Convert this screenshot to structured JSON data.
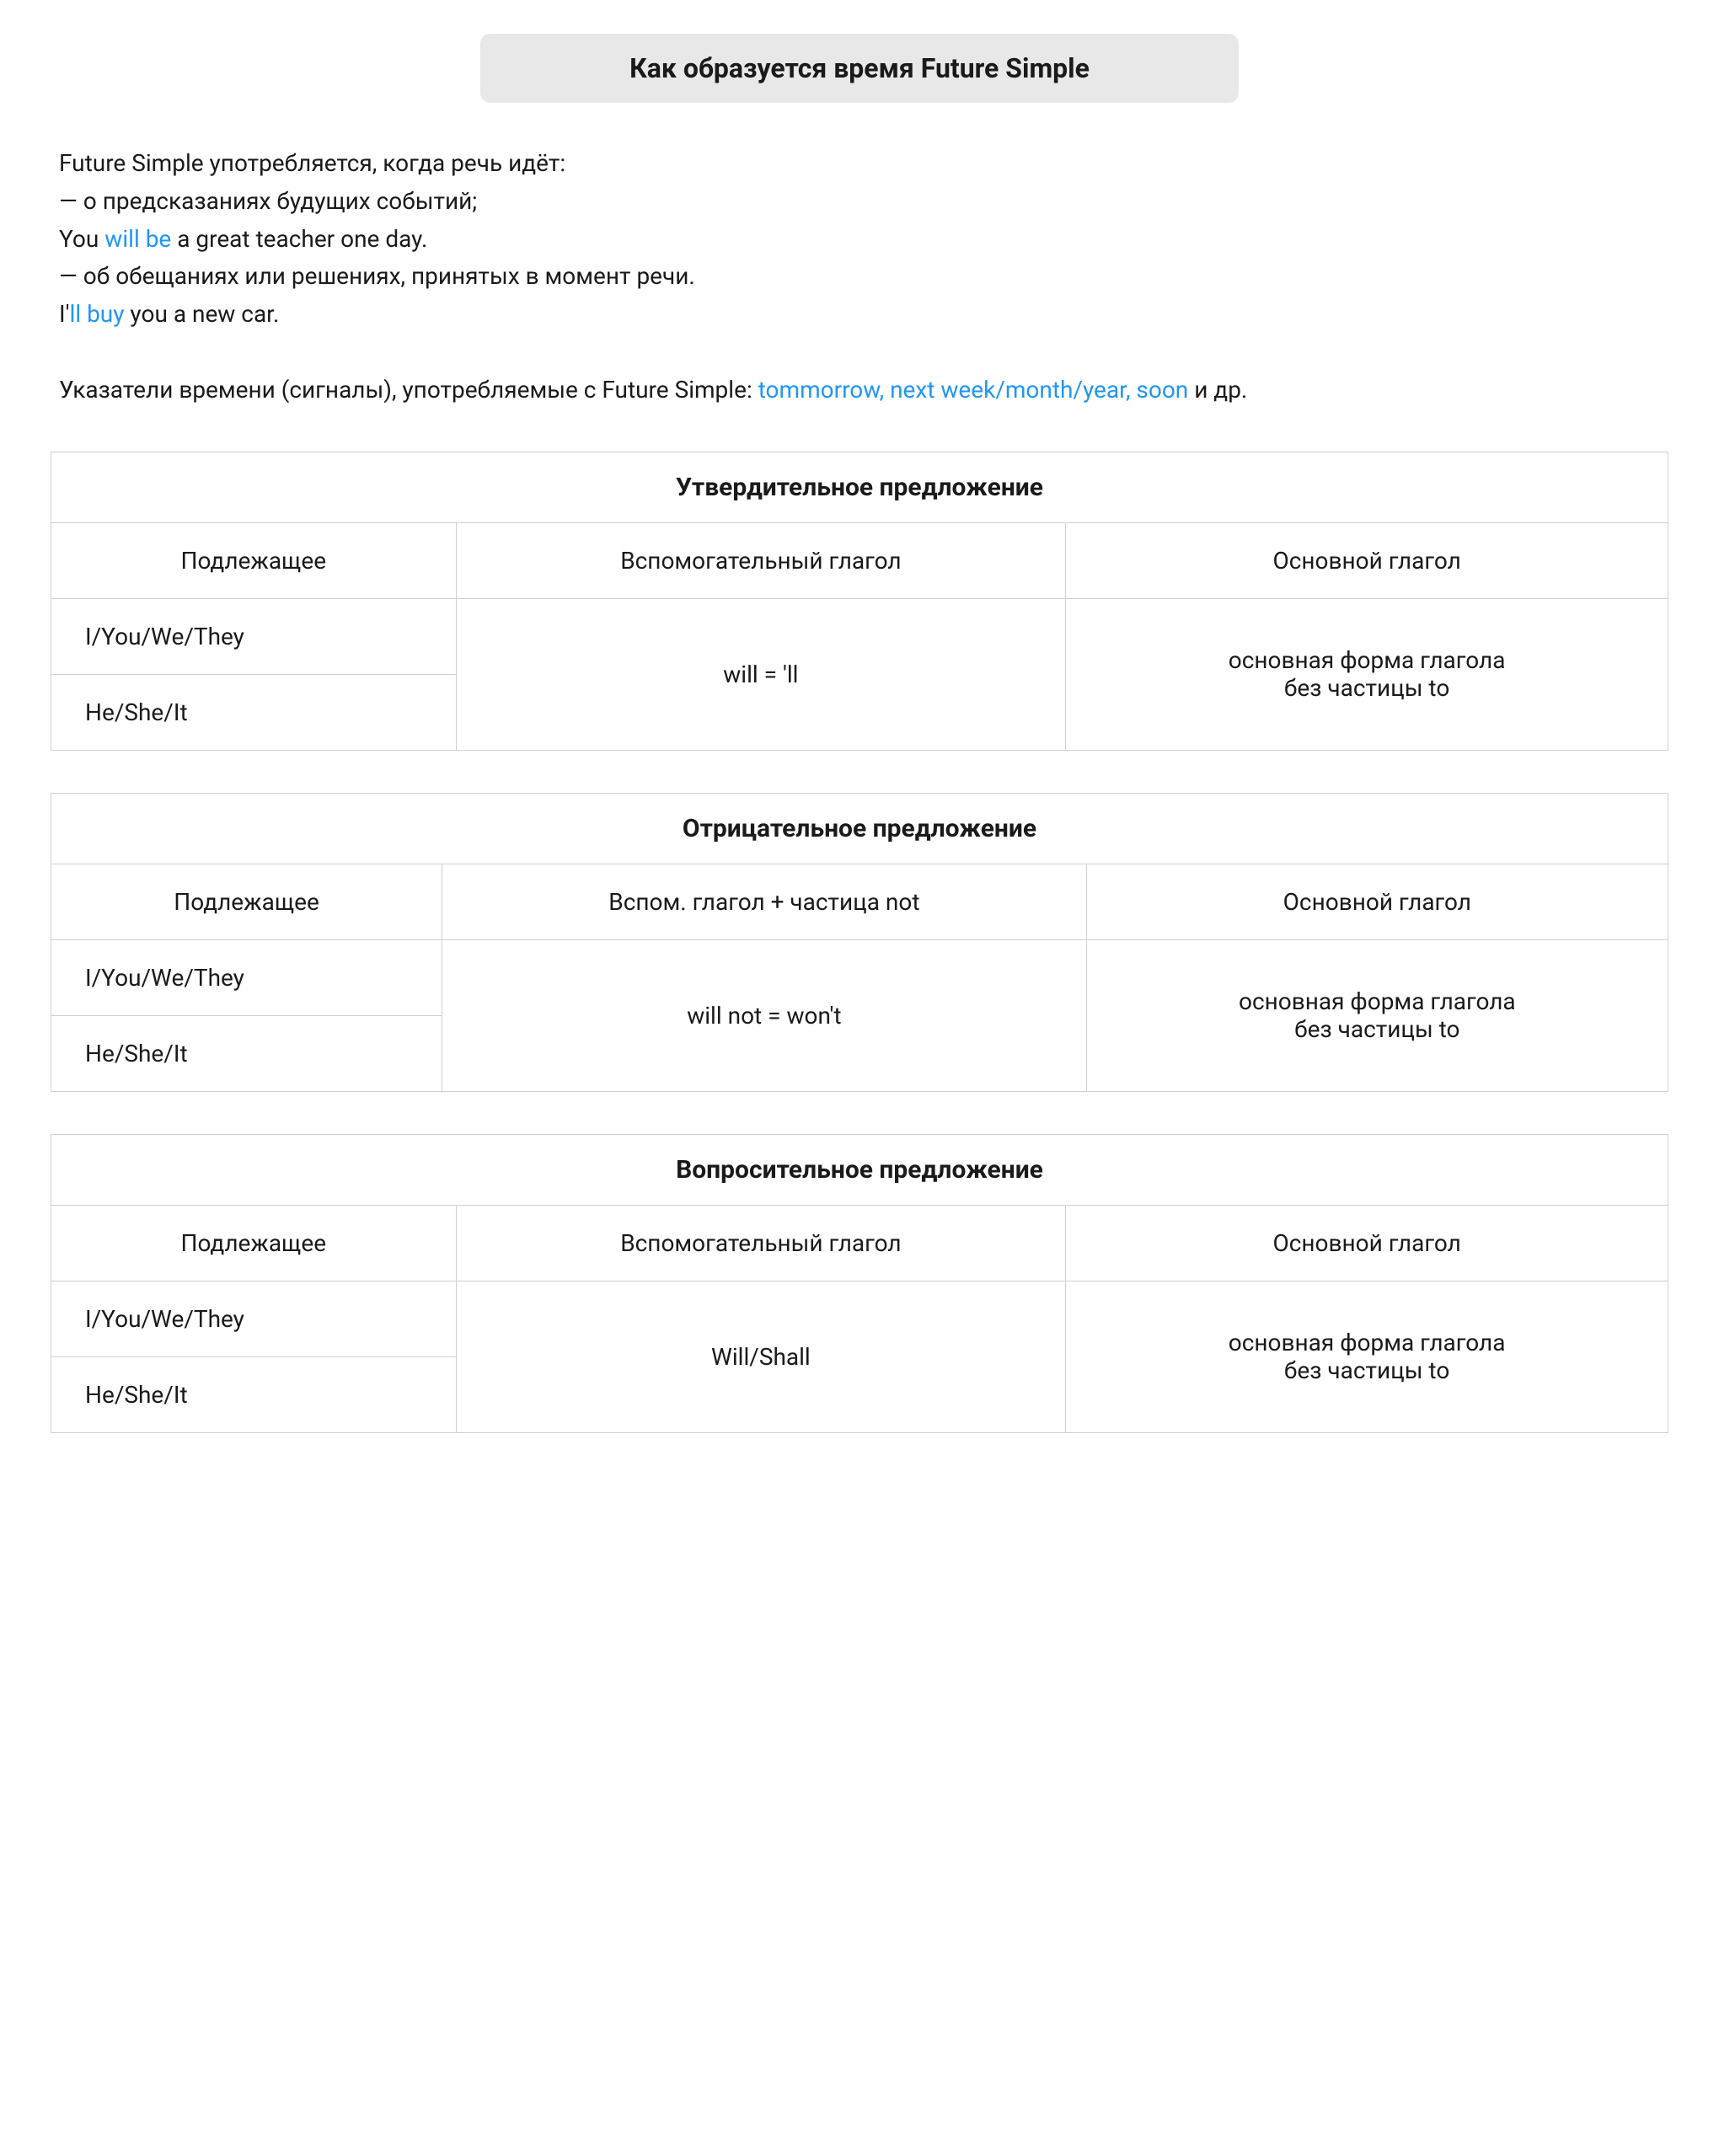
{
  "title": "Как образуется время Future Simple",
  "intro": {
    "line1": "Future Simple употребляется, когда речь идёт:",
    "line2": "— о предсказаниях будущих событий;",
    "line3_prefix": "You ",
    "line3_highlight": "will be",
    "line3_suffix": " a great teacher one day.",
    "line4": "— об обещаниях или решениях, принятых в момент речи.",
    "line5_prefix": "I'",
    "line5_highlight": "ll buy",
    "line5_suffix": " you a new car.",
    "line6_prefix": "Указатели времени (сигналы), употребляемые с Future Simple: ",
    "highlights": "tommorrow, next week/month/year, soon",
    "line6_suffix": " и др."
  },
  "sections": {
    "affirmative": {
      "title": "Утвердительное предложение",
      "headers": [
        "Подлежащее",
        "Вспомогательный глагол",
        "Основной глагол"
      ],
      "subject1": "I/You/We/They",
      "subject2": "He/She/It",
      "aux_verb": "will = 'll",
      "main_verb": "основная форма глагола\nбез частицы to"
    },
    "negative": {
      "title": "Отрицательное предложение",
      "headers": [
        "Подлежащее",
        "Вспом. глагол + частица not",
        "Основной глагол"
      ],
      "subject1": "I/You/We/They",
      "subject2": "He/She/It",
      "aux_verb": "will not = won't",
      "main_verb": "основная форма глагола\nбез частицы to"
    },
    "question": {
      "title": "Вопросительное предложение",
      "headers": [
        "Подлежащее",
        "Вспомогательный глагол",
        "Основной глагол"
      ],
      "subject1": "I/You/We/They",
      "subject2": "He/She/It",
      "aux_verb": "Will/Shall",
      "main_verb": "основная форма глагола\nбез частицы to"
    }
  }
}
